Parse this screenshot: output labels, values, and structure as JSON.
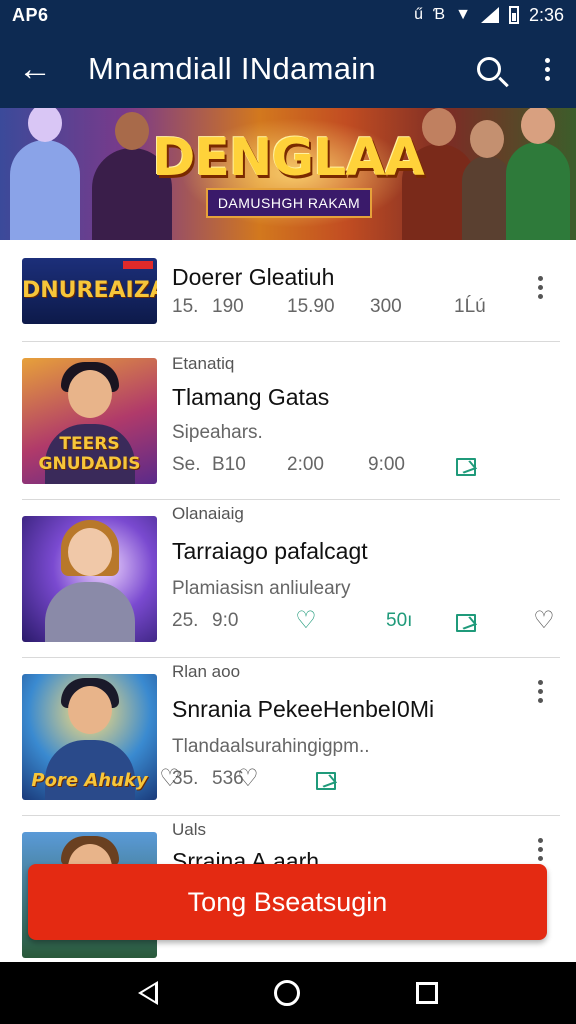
{
  "status_bar": {
    "left": "AP6",
    "time": "2:36",
    "icon_a": "ű",
    "icon_b": "Ɓ"
  },
  "app_bar": {
    "title": "Mnamdiall INdamain",
    "back_icon": "arrow-left-icon",
    "search_icon": "search-icon",
    "more_icon": "more-vert-icon",
    "color": "#0d2a52"
  },
  "banner": {
    "title": "DENGLAA",
    "subtitle": "DAMUSHGH RAKAM"
  },
  "items": [
    {
      "thumb_text": "DNUREAIZA",
      "title": "Doerer Gleatiuh",
      "stats": [
        "15.",
        "190",
        "15.90",
        "300",
        "1Ĺú"
      ]
    },
    {
      "category": "Etanatiq",
      "title": "Tlamang Gatas",
      "desc": "Sipeahars.",
      "thumb_text": "TEERS GNUDADIS",
      "stats": [
        "Se.",
        "B10",
        "2:00",
        "9:00"
      ]
    },
    {
      "category": "Olanaiaig",
      "title": "Tarraiago pafalcagt",
      "desc": "Plamiasisn anliuleary",
      "stats": [
        "25.",
        "9:0",
        "50ı"
      ]
    },
    {
      "category": "Rlan aoo",
      "title": "Snrania PekeeHenbeI0Mi",
      "desc": "Tlandaalsurahingigpm..",
      "thumb_text": "Pore Ahuky",
      "stats": [
        "35.",
        "536"
      ]
    },
    {
      "category": "Uals",
      "title": "Srraina A.aarh"
    }
  ],
  "cta": {
    "label": "Tong Bseatsugin",
    "color": "#e42a12"
  }
}
